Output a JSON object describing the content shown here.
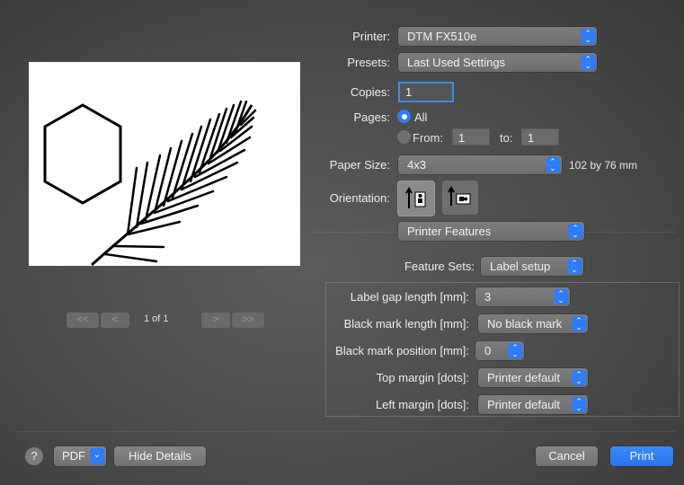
{
  "printer": {
    "label": "Printer:",
    "value": "DTM FX510e"
  },
  "presets": {
    "label": "Presets:",
    "value": "Last Used Settings"
  },
  "copies": {
    "label": "Copies:",
    "value": "1"
  },
  "pages": {
    "label": "Pages:",
    "all_label": "All",
    "from_label": "From:",
    "from_value": "1",
    "to_label": "to:",
    "to_value": "1"
  },
  "paper_size": {
    "label": "Paper Size:",
    "value": "4x3",
    "dimensions": "102 by 76 mm"
  },
  "orientation": {
    "label": "Orientation:"
  },
  "section_popup": {
    "value": "Printer Features"
  },
  "feature_sets": {
    "label": "Feature Sets:",
    "value": "Label setup"
  },
  "features": [
    {
      "label": "Label gap length [mm]:",
      "value": "3"
    },
    {
      "label": "Black mark length [mm]:",
      "value": "No black mark"
    },
    {
      "label": "Black mark position [mm]:",
      "value": "0"
    },
    {
      "label": "Top margin [dots]:",
      "value": "Printer default"
    },
    {
      "label": "Left margin [dots]:",
      "value": "Printer default"
    }
  ],
  "preview_nav": {
    "page_text": "1 of 1",
    "first": "<<",
    "prev": "<",
    "next": ">",
    "last": ">>"
  },
  "footer": {
    "help": "?",
    "pdf": "PDF",
    "hide_details": "Hide Details",
    "cancel": "Cancel",
    "print": "Print"
  },
  "colors": {
    "accent": "#2f7cf6",
    "background": "#4a4a4a"
  },
  "icons": {
    "chevron_updown": "⌃⌄",
    "chevron_down": "⌄"
  }
}
